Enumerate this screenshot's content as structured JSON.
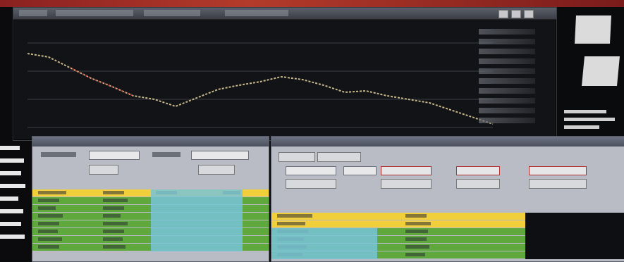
{
  "colors": {
    "yellow_row": "#f0cf3a",
    "green_row": "#5fa83c",
    "blue_row": "#78c3d8",
    "chart_bg": "#121317",
    "panel_bg": "#b9bcc4",
    "banner_red": "#b33b2b"
  },
  "icons": [
    "minimize-icon",
    "maximize-icon",
    "close-icon"
  ],
  "left_panel_rows": 8,
  "order_window": {
    "rows": [
      {
        "color": "yellow"
      },
      {
        "color": "green"
      },
      {
        "color": "green"
      },
      {
        "color": "green"
      },
      {
        "color": "green"
      },
      {
        "color": "green"
      },
      {
        "color": "green"
      },
      {
        "color": "green"
      }
    ]
  },
  "position_window": {
    "rows": [
      {
        "color": "yellow"
      },
      {
        "color": "yellow"
      },
      {
        "color": "green"
      },
      {
        "color": "green"
      },
      {
        "color": "green"
      },
      {
        "color": "green"
      }
    ]
  }
}
